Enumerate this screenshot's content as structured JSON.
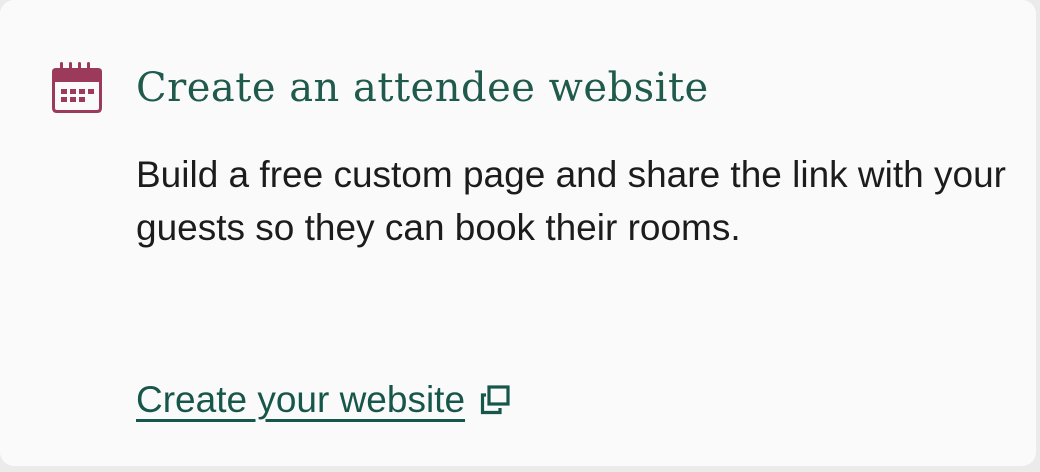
{
  "card": {
    "icon": "calendar-icon",
    "title": "Create an attendee website",
    "description": "Build a free custom page and share the link with your guests so they can book their rooms.",
    "link_label": "Create your website",
    "link_icon": "external-link-icon"
  },
  "colors": {
    "title": "#1f5a4c",
    "link": "#17564a",
    "icon": "#9b3a5b",
    "text": "#1c1c1c",
    "card_background": "#fafafa"
  }
}
